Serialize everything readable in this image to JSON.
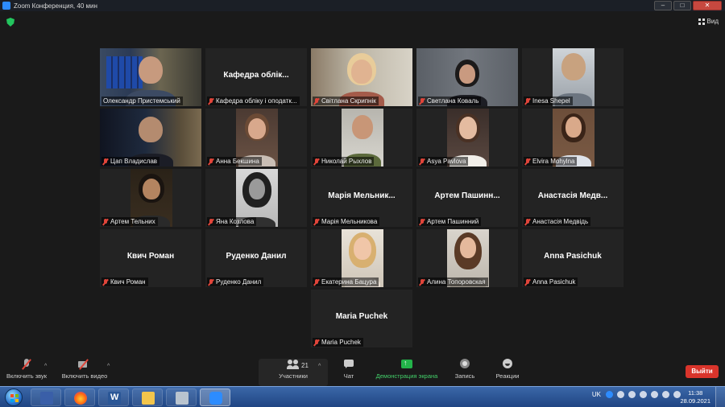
{
  "window": {
    "title": "Zoom Конференция, 40 мин"
  },
  "top": {
    "view_label": "Вид"
  },
  "participants": [
    {
      "name": "Олександр Пристемський",
      "center": "",
      "video": true
    },
    {
      "name": "Кафедра обліку і оподатк...",
      "center": "Кафедра облік...",
      "video": false
    },
    {
      "name": "Світлана Скрипнік",
      "center": "",
      "video": true
    },
    {
      "name": "Светлана Коваль",
      "center": "",
      "video": true
    },
    {
      "name": "Inesa Shepel",
      "center": "",
      "video": true
    },
    {
      "name": "Цап Владислав",
      "center": "",
      "video": true
    },
    {
      "name": "Анна Бекшина",
      "center": "",
      "video": true
    },
    {
      "name": "Николай Рыхлов",
      "center": "",
      "video": true
    },
    {
      "name": "Asya Pavlova",
      "center": "",
      "video": true
    },
    {
      "name": "Elvira Mohylna",
      "center": "",
      "video": true
    },
    {
      "name": "Артем Тельних",
      "center": "",
      "video": true
    },
    {
      "name": "Яна Козлова",
      "center": "",
      "video": true
    },
    {
      "name": "Марія Мельникова",
      "center": "Марія Мельник...",
      "video": false
    },
    {
      "name": "Артем Пашинний",
      "center": "Артем Пашинн...",
      "video": false
    },
    {
      "name": "Анастасія Медвідь",
      "center": "Анастасія Медв...",
      "video": false
    },
    {
      "name": "Квич Роман",
      "center": "Квич Роман",
      "video": false
    },
    {
      "name": "Руденко Данил",
      "center": "Руденко Данил",
      "video": false
    },
    {
      "name": "Екатерина Бацура",
      "center": "",
      "video": true
    },
    {
      "name": "Алина Топоровская",
      "center": "",
      "video": true
    },
    {
      "name": "Anna Pasichuk",
      "center": "Anna Pasichuk",
      "video": false
    },
    {
      "name": "Maria Puchek",
      "center": "Maria Puchek",
      "video": false
    }
  ],
  "toolbar": {
    "unmute_label": "Включить звук",
    "start_video_label": "Включить видео",
    "participants_label": "Участники",
    "participants_count": "21",
    "chat_label": "Чат",
    "share_label": "Демонстрация экрана",
    "record_label": "Запись",
    "reactions_label": "Реакции",
    "leave_label": "Выйти"
  },
  "taskbar": {
    "language": "UK",
    "time": "11:38",
    "date": "28.09.2021"
  },
  "colors": {
    "active_speaker": "#d9e854",
    "share_green": "#23b34a",
    "leave_red": "#d9342b",
    "mute_red": "#e0453a"
  }
}
